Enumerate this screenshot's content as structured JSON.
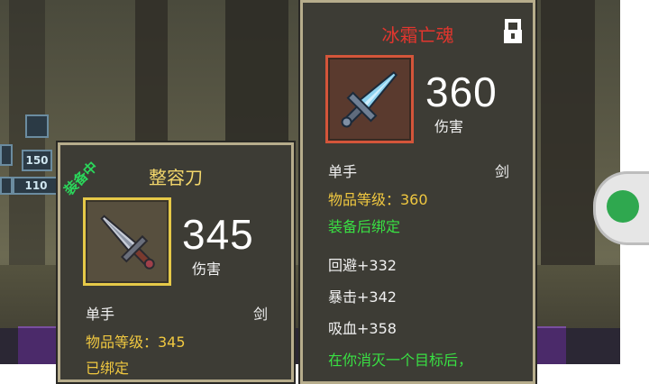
{
  "hud": {
    "tile1": "150",
    "tile2": "110"
  },
  "left_card": {
    "badge": "装备中",
    "name": "整容刀",
    "damage_value": "345",
    "damage_label": "伤害",
    "hand_type": "单手",
    "weapon_type": "剑",
    "item_level": "物品等级：345",
    "bind_status": "已绑定",
    "name_color": "#f2d66b",
    "frame_color": "#e6c948"
  },
  "right_card": {
    "name": "冰霜亡魂",
    "damage_value": "360",
    "damage_label": "伤害",
    "hand_type": "单手",
    "weapon_type": "剑",
    "item_level": "物品等级：360",
    "bind_status": "装备后绑定",
    "stats": [
      "回避+332",
      "暴击+342",
      "吸血+358"
    ],
    "effect_text": "在你消灭一个目标后，",
    "name_color": "#e2362e",
    "frame_color": "#d4553a",
    "lock_icon": "lock-icon"
  },
  "side_button_icon": "chat-icon"
}
